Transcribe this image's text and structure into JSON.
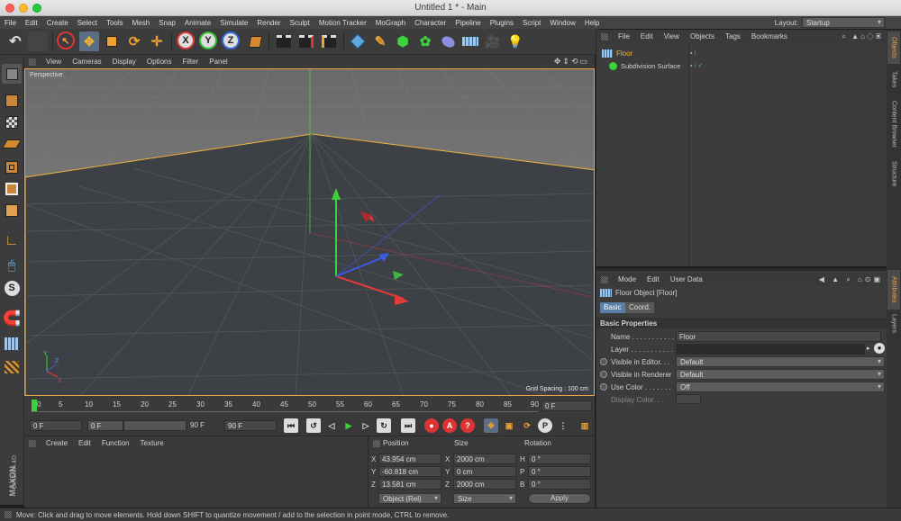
{
  "window": {
    "title": "Untitled 1 * - Main"
  },
  "menu": [
    "File",
    "Edit",
    "Create",
    "Select",
    "Tools",
    "Mesh",
    "Snap",
    "Animate",
    "Simulate",
    "Render",
    "Sculpt",
    "Motion Tracker",
    "MoGraph",
    "Character",
    "Pipeline",
    "Plugins",
    "Script",
    "Window",
    "Help"
  ],
  "layout": {
    "label": "Layout:",
    "value": "Startup"
  },
  "viewport": {
    "menu": [
      "View",
      "Cameras",
      "Display",
      "Options",
      "Filter",
      "Panel"
    ],
    "label": "Perspective",
    "grid_spacing": "Grid Spacing : 100 cm"
  },
  "timeline": {
    "ticks": [
      "0",
      "5",
      "10",
      "15",
      "20",
      "25",
      "30",
      "35",
      "40",
      "45",
      "50",
      "55",
      "60",
      "65",
      "70",
      "75",
      "80",
      "85",
      "90"
    ],
    "current_frame": "0 F",
    "start_frame": "0 F",
    "range_start": "0 F",
    "range_end": "90 F",
    "end_frame": "90 F"
  },
  "material_manager": {
    "menu": [
      "Create",
      "Edit",
      "Function",
      "Texture"
    ]
  },
  "coordinates": {
    "headers": [
      "Position",
      "Size",
      "Rotation"
    ],
    "rows": [
      {
        "axis": "X",
        "pos": "43.954 cm",
        "size_axis": "X",
        "size": "2000 cm",
        "rot_axis": "H",
        "rot": "0 °"
      },
      {
        "axis": "Y",
        "pos": "-60.818 cm",
        "size_axis": "Y",
        "size": "0 cm",
        "rot_axis": "P",
        "rot": "0 °"
      },
      {
        "axis": "Z",
        "pos": "13.581 cm",
        "size_axis": "Z",
        "size": "2000 cm",
        "rot_axis": "B",
        "rot": "0 °"
      }
    ],
    "mode": "Object (Rel)",
    "size_mode": "Size",
    "apply": "Apply"
  },
  "object_manager": {
    "menu": [
      "File",
      "Edit",
      "View",
      "Objects",
      "Tags",
      "Bookmarks"
    ],
    "objects": [
      {
        "name": "Floor",
        "selected": true
      },
      {
        "name": "Subdivision Surface",
        "selected": false
      }
    ]
  },
  "attributes": {
    "menu": [
      "Mode",
      "Edit",
      "User Data"
    ],
    "object_title": "Floor Object [Floor]",
    "tabs": [
      "Basic",
      "Coord."
    ],
    "section": "Basic Properties",
    "fields": [
      {
        "label": "Name . . . . . . . . . . .",
        "value": "Floor"
      },
      {
        "label": "Layer . . . . . . . . . . .",
        "value": ""
      },
      {
        "label": "Visible in Editor. . .",
        "value": "Default"
      },
      {
        "label": "Visible in Renderer",
        "value": "Default"
      },
      {
        "label": "Use Color . . . . . . .",
        "value": "Off"
      },
      {
        "label": "Display Color. . .",
        "value": ""
      }
    ]
  },
  "right_tabs": [
    "Objects",
    "Takes",
    "Content Browser",
    "Structure",
    "Attributes",
    "Layers"
  ],
  "brand": {
    "line1": "MAXON",
    "line2": "CINEMA 4D"
  },
  "status": "Move: Click and drag to move elements. Hold down SHIFT to quantize movement / add to the selection in point mode, CTRL to remove.",
  "colors": {
    "accent": "#f0a54a",
    "selection": "#f2b33d",
    "x_axis": "#e23b3b",
    "y_axis": "#3bd23b",
    "z_axis": "#3b5be2"
  }
}
